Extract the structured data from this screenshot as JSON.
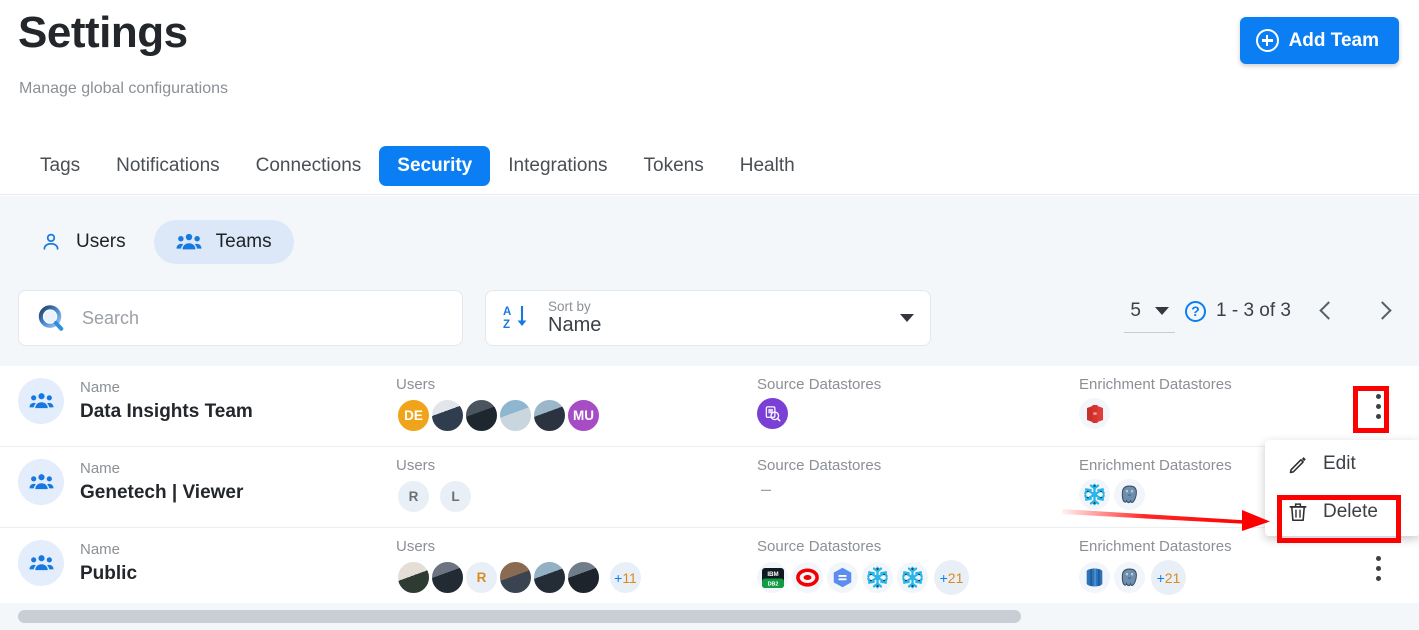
{
  "header": {
    "title": "Settings",
    "subtitle": "Manage global configurations",
    "add_button": "Add Team",
    "add_icon": "plus-circle-icon"
  },
  "tabs": [
    {
      "label": "Tags",
      "active": false
    },
    {
      "label": "Notifications",
      "active": false
    },
    {
      "label": "Connections",
      "active": false
    },
    {
      "label": "Security",
      "active": true
    },
    {
      "label": "Integrations",
      "active": false
    },
    {
      "label": "Tokens",
      "active": false
    },
    {
      "label": "Health",
      "active": false
    }
  ],
  "segmented": {
    "users": {
      "label": "Users",
      "icon": "person-icon",
      "active": false
    },
    "teams": {
      "label": "Teams",
      "icon": "people-group-icon",
      "active": true
    }
  },
  "search": {
    "placeholder": "Search",
    "value": "",
    "icon": "search-icon"
  },
  "sort": {
    "label": "Sort by",
    "value": "Name",
    "icon": "sort-alpha-descending-icon"
  },
  "pagination": {
    "page_size": "5",
    "help_icon": "help-circle-icon",
    "range": "1 - 3 of 3",
    "prev_icon": "chevron-left-icon",
    "next_icon": "chevron-right-icon"
  },
  "table": {
    "labels": {
      "name": "Name",
      "users": "Users",
      "source": "Source Datastores",
      "enrichment": "Enrichment Datastores"
    },
    "rows": [
      {
        "name": "Data Insights Team",
        "team_icon": "people-group-icon",
        "users": [
          {
            "type": "initials",
            "text": "DE",
            "color": "#f0a41b"
          },
          {
            "type": "photo",
            "color": "#4a5a6a"
          },
          {
            "type": "photo",
            "color": "#2f3a44"
          },
          {
            "type": "photo",
            "color": "#6b8ba3"
          },
          {
            "type": "photo",
            "color": "#55616e"
          },
          {
            "type": "initials",
            "text": "MU",
            "color": "#a64cc4"
          }
        ],
        "users_more": "",
        "source_datastores": [
          {
            "name": "athena",
            "color": "#7a3fd4"
          }
        ],
        "source_more": "",
        "source_empty": "",
        "enrichment_datastores": [
          {
            "name": "redshift",
            "color": "#c9302c"
          }
        ],
        "enrichment_more": "",
        "menu_icon": "kebab-menu-icon"
      },
      {
        "name": "Genetech | Viewer",
        "team_icon": "people-group-icon",
        "users": [
          {
            "type": "initials",
            "text": "R",
            "color": "#e9eff6"
          },
          {
            "type": "initials",
            "text": "L",
            "color": "#e9eff6"
          }
        ],
        "users_more": "",
        "source_datastores": [],
        "source_more": "",
        "source_empty": "–",
        "enrichment_datastores": [
          {
            "name": "snowflake",
            "color": "#29b5e8"
          },
          {
            "name": "postgresql",
            "color": "#336791"
          }
        ],
        "enrichment_more": "",
        "menu_icon": "kebab-menu-icon"
      },
      {
        "name": "Public",
        "team_icon": "people-group-icon",
        "users": [
          {
            "type": "photo",
            "color": "#d8cfc6"
          },
          {
            "type": "photo",
            "color": "#2d3640"
          },
          {
            "type": "initials",
            "text": "R",
            "color": "#e9eff6"
          },
          {
            "type": "photo",
            "color": "#7a5c44"
          },
          {
            "type": "photo",
            "color": "#5c6b7a"
          },
          {
            "type": "photo",
            "color": "#3a4450"
          }
        ],
        "users_more": "+11",
        "source_datastores": [
          {
            "name": "ibm-db2",
            "color": "#1f9c4a"
          },
          {
            "name": "oracle",
            "color": "#f20000"
          },
          {
            "name": "bigquery",
            "color": "#4285f4"
          },
          {
            "name": "snowflake",
            "color": "#29b5e8"
          },
          {
            "name": "snowflake",
            "color": "#29b5e8"
          }
        ],
        "source_more": "+21",
        "source_empty": "",
        "enrichment_datastores": [
          {
            "name": "amazon-rds",
            "color": "#2e73b8"
          },
          {
            "name": "postgresql",
            "color": "#336791"
          }
        ],
        "enrichment_more": "+21",
        "menu_icon": "kebab-menu-icon"
      }
    ]
  },
  "context_menu": {
    "items": [
      {
        "label": "Edit",
        "icon": "pencil-icon"
      },
      {
        "label": "Delete",
        "icon": "trash-icon"
      }
    ]
  },
  "annotations": {
    "highlight_color": "#ff0000",
    "arrow_color": "#ff0000"
  }
}
